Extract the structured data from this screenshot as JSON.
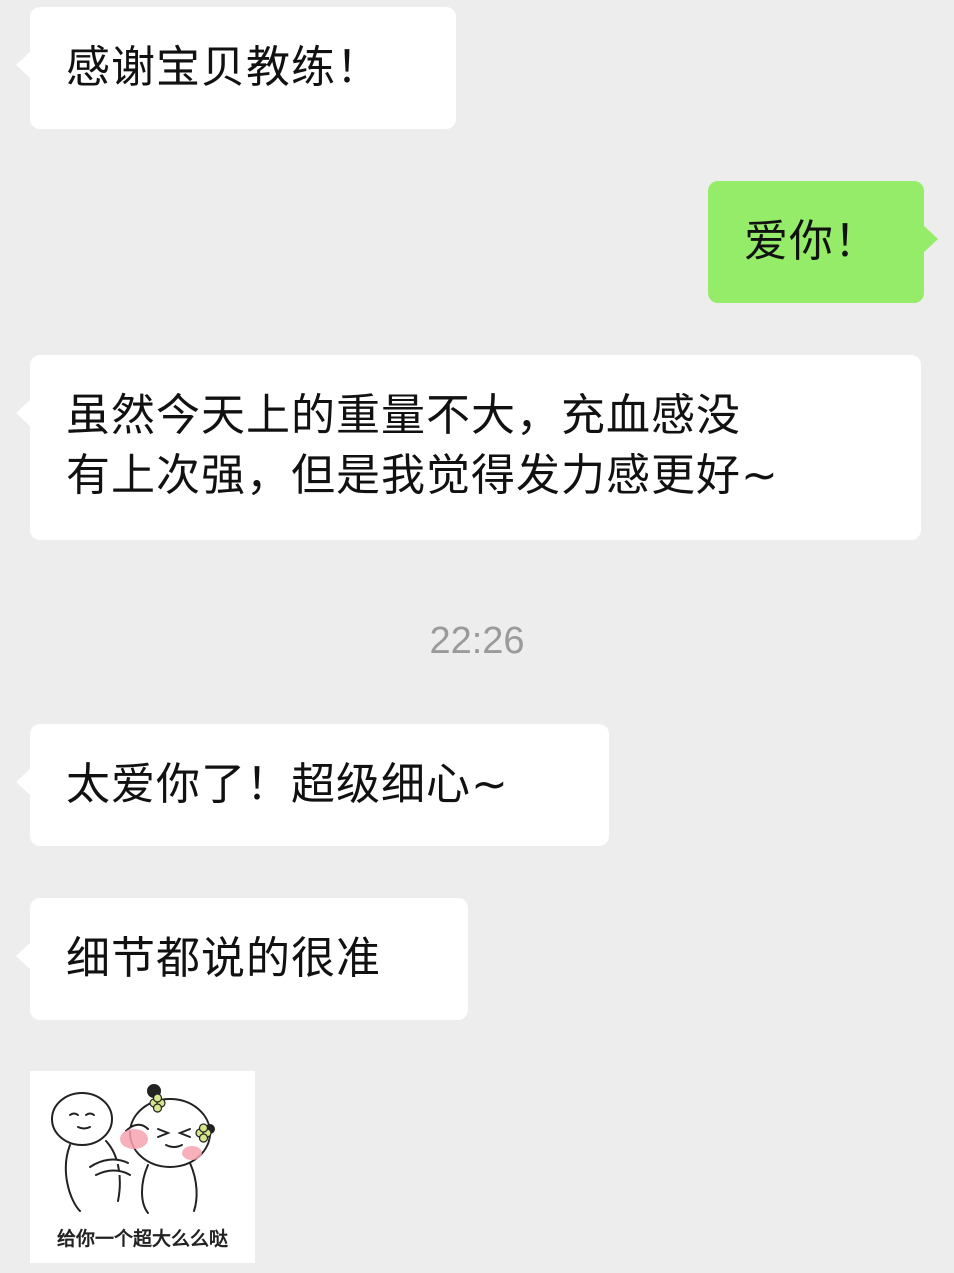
{
  "messages": [
    {
      "side": "left",
      "text": "感谢宝贝教练！"
    },
    {
      "side": "right",
      "text": "爱你！"
    },
    {
      "side": "left",
      "text": "虽然今天上的重量不大，充血感没\n有上次强，但是我觉得发力感更好~"
    },
    {
      "side": "left",
      "text": "太爱你了！超级细心~"
    },
    {
      "side": "left",
      "text": "细节都说的很准"
    }
  ],
  "timestamp": "22:26",
  "sticker": {
    "caption": "给你一个超大么么哒",
    "icon": "hugging-cheeks-sticker"
  },
  "colors": {
    "background": "#ededed",
    "incoming_bubble": "#ffffff",
    "outgoing_bubble": "#95ec69",
    "timestamp": "#9a9a9a"
  }
}
